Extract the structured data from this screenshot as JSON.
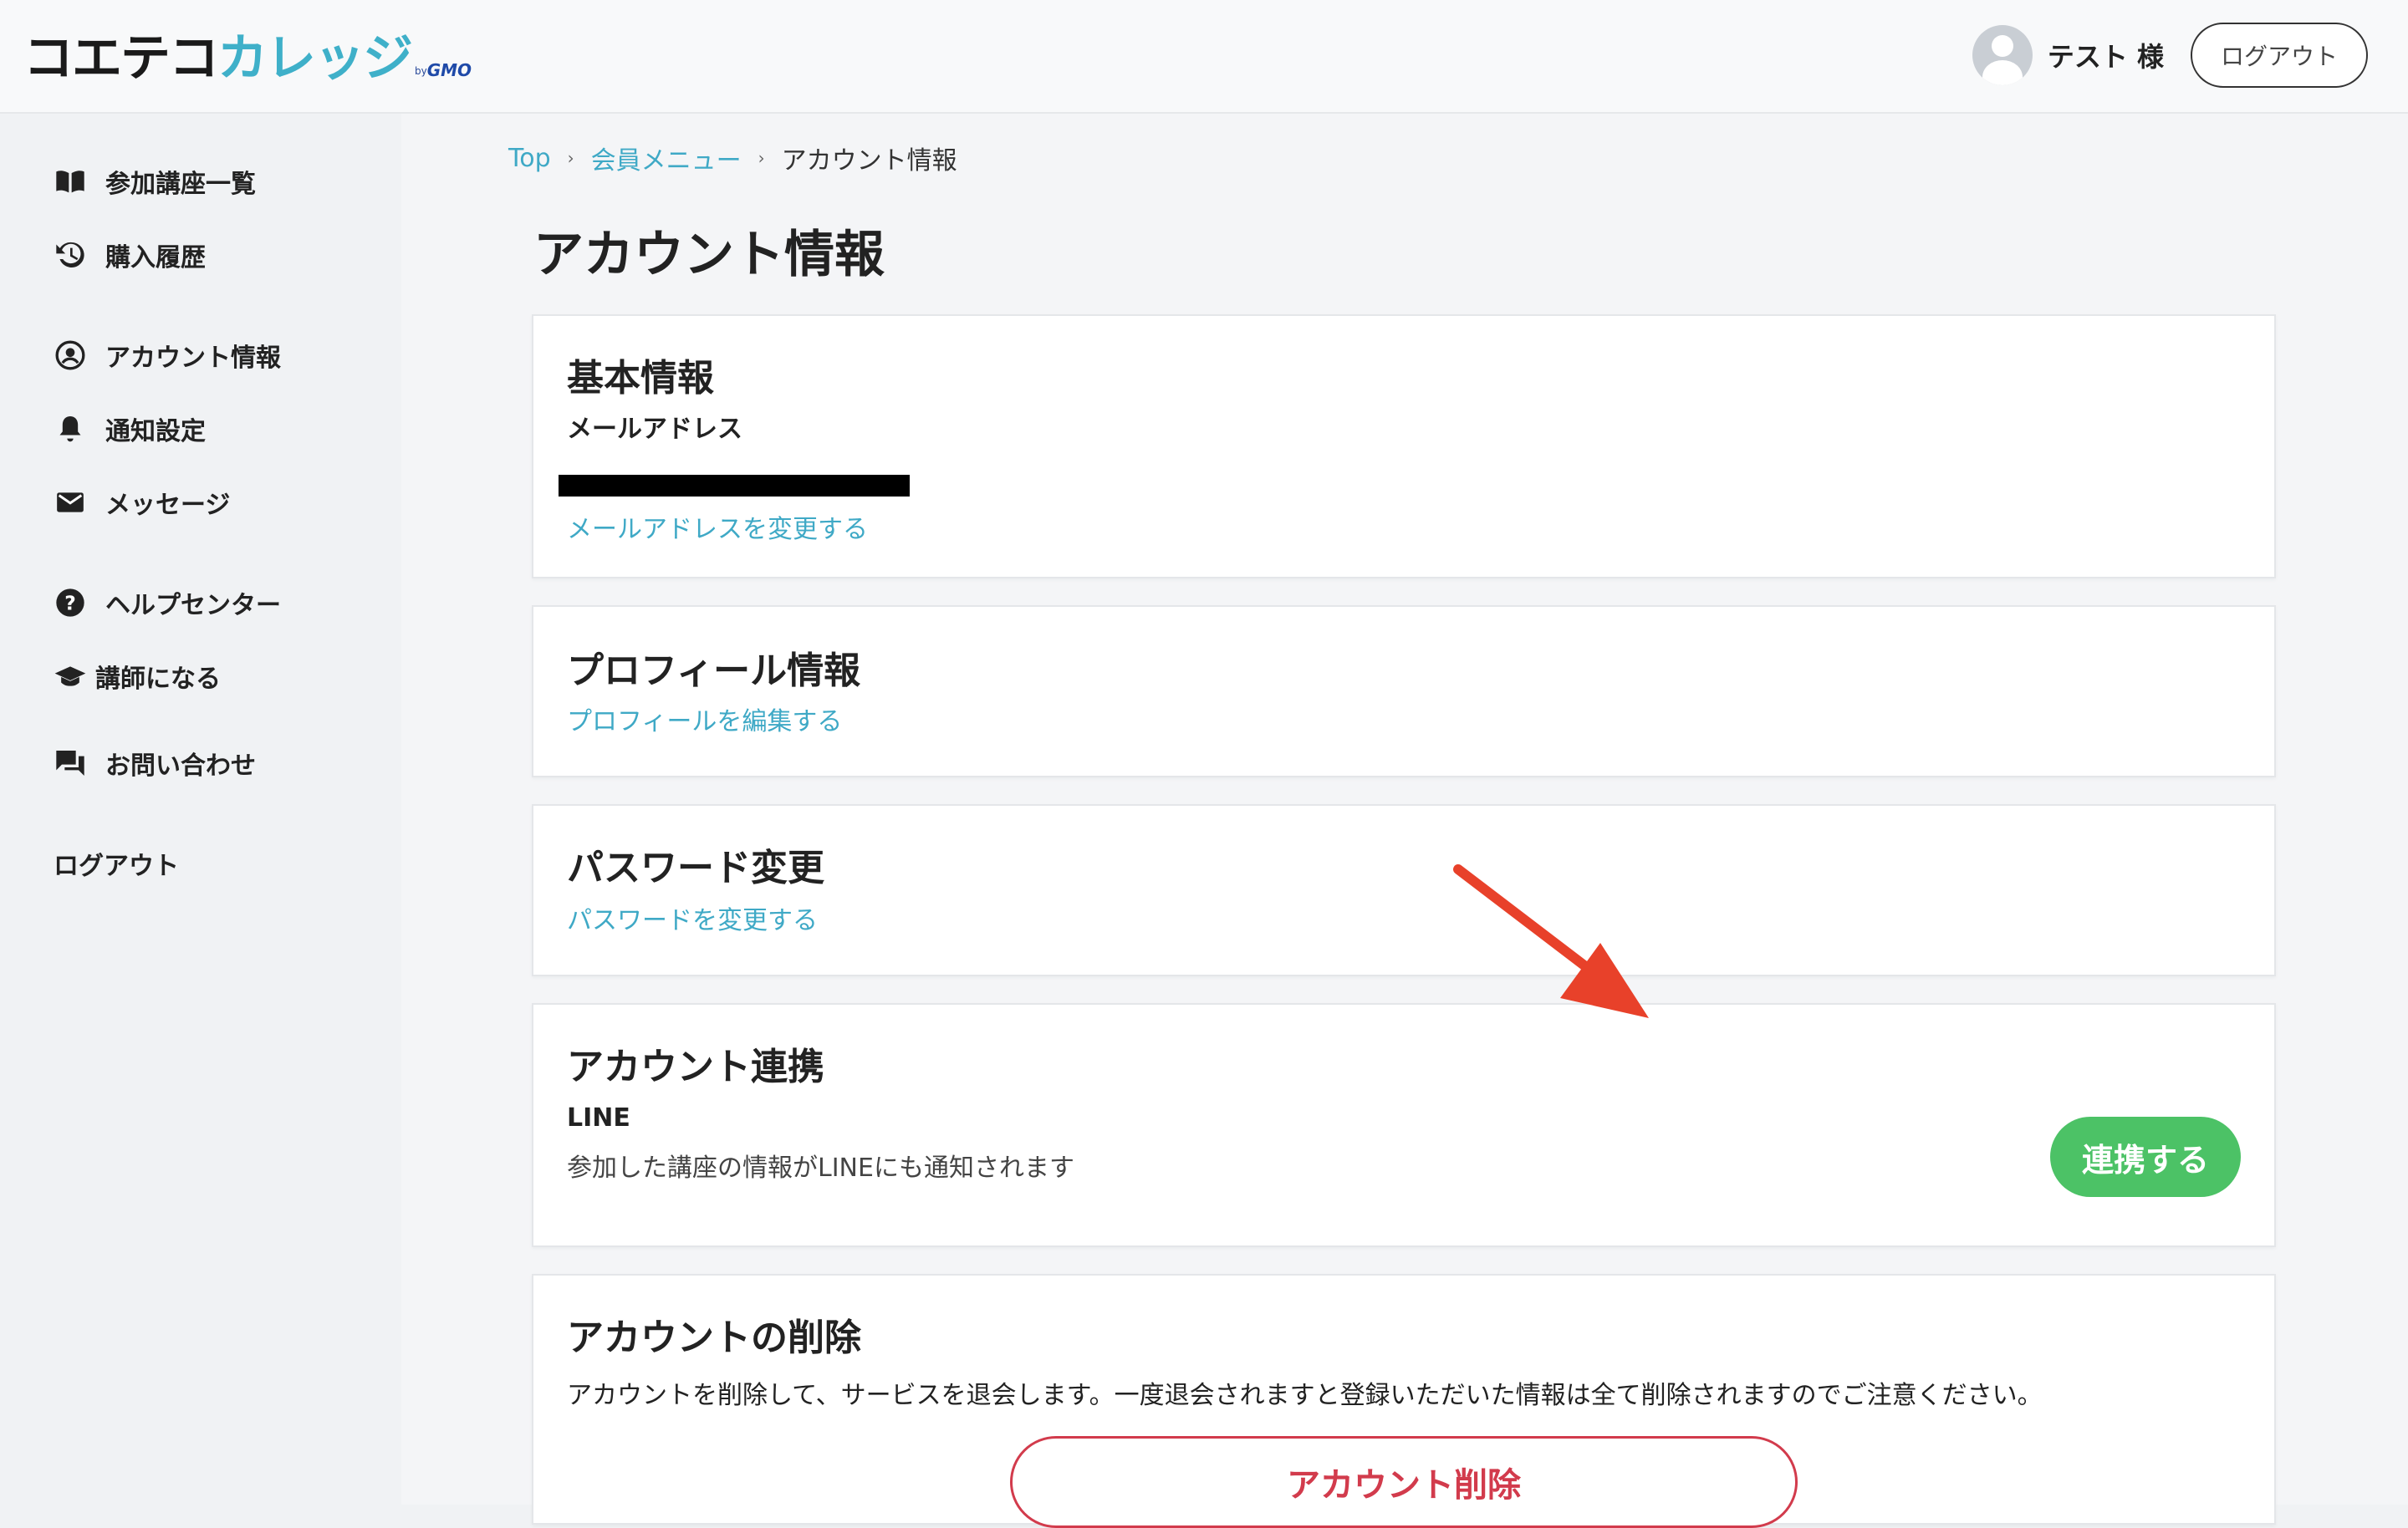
{
  "header": {
    "logo_main": "コエテコ",
    "logo_accent": "カレッジ",
    "logo_by": "by",
    "logo_gmo": "GMO",
    "user_name": "テスト 様",
    "logout_label": "ログアウト"
  },
  "sidebar": {
    "items": [
      {
        "label": "参加講座一覧",
        "icon": "book-icon"
      },
      {
        "label": "購入履歴",
        "icon": "history-icon"
      },
      {
        "label": "アカウント情報",
        "icon": "account-circle-icon"
      },
      {
        "label": "通知設定",
        "icon": "bell-icon"
      },
      {
        "label": "メッセージ",
        "icon": "mail-icon"
      },
      {
        "label": "ヘルプセンター",
        "icon": "help-icon"
      },
      {
        "label": "講師になる",
        "icon": "graduation-cap-icon"
      },
      {
        "label": "お問い合わせ",
        "icon": "chat-icon"
      },
      {
        "label": "ログアウト"
      }
    ]
  },
  "breadcrumb": {
    "top": "Top",
    "member_menu": "会員メニュー",
    "current": "アカウント情報"
  },
  "page_title": "アカウント情報",
  "cards": {
    "basic": {
      "title": "基本情報",
      "email_label": "メールアドレス",
      "change_email_link": "メールアドレスを変更する"
    },
    "profile": {
      "title": "プロフィール情報",
      "edit_link": "プロフィールを編集する"
    },
    "password": {
      "title": "パスワード変更",
      "change_link": "パスワードを変更する"
    },
    "linking": {
      "title": "アカウント連携",
      "service": "LINE",
      "description": "参加した講座の情報がLINEにも通知されます",
      "connect_label": "連携する"
    },
    "delete": {
      "title": "アカウントの削除",
      "description": "アカウントを削除して、サービスを退会します。一度退会されますと登録いただいた情報は全て削除されますのでご注意ください。",
      "delete_label": "アカウント削除"
    }
  },
  "colors": {
    "accent_link": "#3fa9c6",
    "connect_green": "#4cc266",
    "delete_red": "#d23b4c",
    "annotation_arrow": "#e8412a"
  }
}
